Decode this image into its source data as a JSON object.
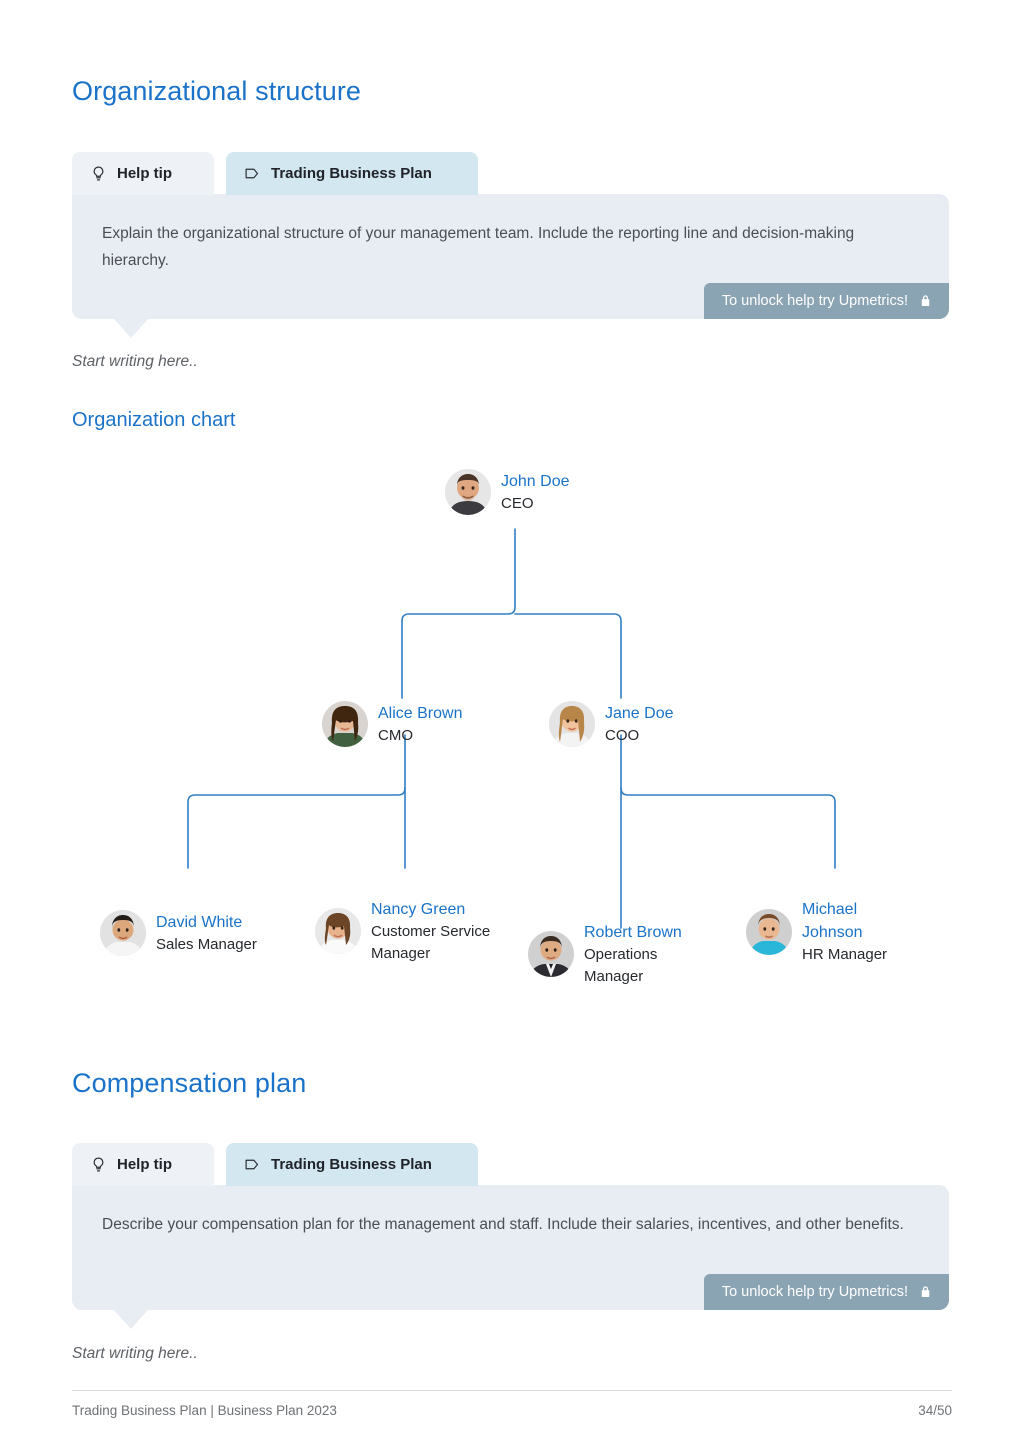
{
  "sections": [
    {
      "heading": "Organizational structure",
      "tabs": {
        "help_label": "Help tip",
        "plan_label": "Trading Business Plan"
      },
      "tip_text": "Explain the organizational structure of your management team. Include the reporting line and decision-making hierarchy.",
      "unlock_label": "To unlock help try Upmetrics!",
      "placeholder": "Start writing here.."
    },
    {
      "heading": "Compensation plan",
      "tabs": {
        "help_label": "Help tip",
        "plan_label": "Trading Business Plan"
      },
      "tip_text": "Describe your compensation plan for the management and staff. Include their salaries, incentives, and other benefits.",
      "unlock_label": "To unlock help try Upmetrics!",
      "placeholder": "Start writing here.."
    }
  ],
  "org_chart": {
    "heading": "Organization chart",
    "nodes": [
      {
        "name": "John Doe",
        "role": "CEO",
        "avatar": "male-1"
      },
      {
        "name": "Alice Brown",
        "role": "CMO",
        "avatar": "female-1"
      },
      {
        "name": "Jane Doe",
        "role": "COO",
        "avatar": "female-2"
      },
      {
        "name": "David White",
        "role": "Sales Manager",
        "avatar": "male-2"
      },
      {
        "name": "Nancy Green",
        "role": "Customer Service\nManager",
        "avatar": "female-3"
      },
      {
        "name": "Robert Brown",
        "role": "Operations\nManager",
        "avatar": "male-3"
      },
      {
        "name": "Michael\nJohnson",
        "role": "HR Manager",
        "avatar": "male-4"
      }
    ],
    "line_color": "#2f7fc4"
  },
  "footer": {
    "left": "Trading Business Plan | Business Plan 2023",
    "right": "34/50"
  },
  "colors": {
    "heading": "#1a73c8",
    "tip_bg": "#e8ecf3",
    "tab_active": "#d3e7f0",
    "tab_inactive": "#eef1f6",
    "unlock_bg": "#8ba4b4",
    "link": "#1a73c8"
  },
  "icons": {
    "help": "lightbulb-icon",
    "plan": "tag-icon",
    "lock": "lock-icon"
  }
}
